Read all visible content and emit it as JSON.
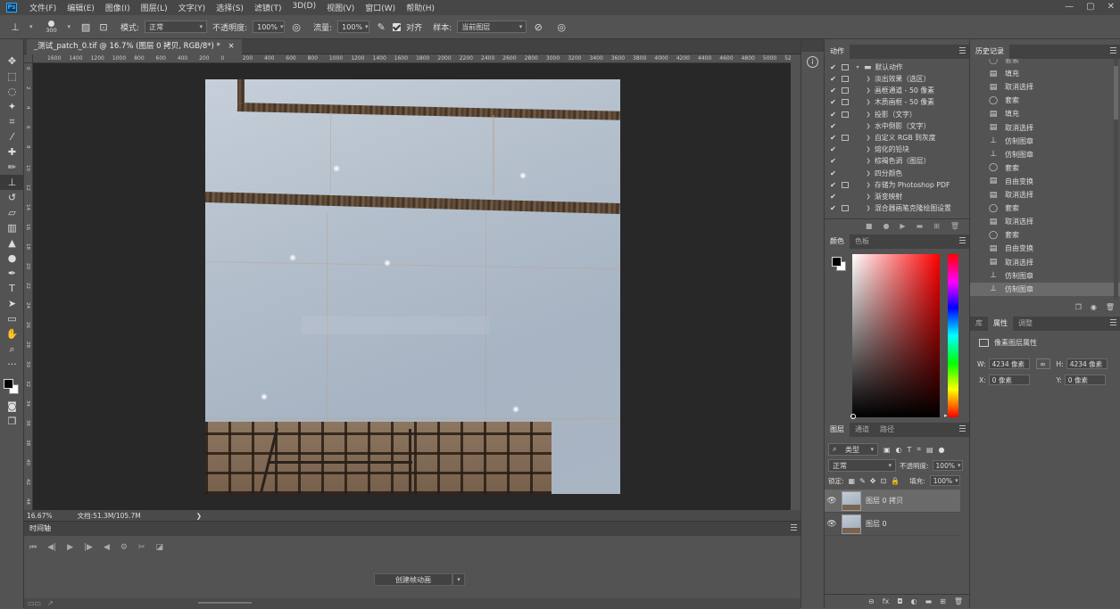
{
  "app": {
    "logo": "Ps"
  },
  "menu": [
    "文件(F)",
    "编辑(E)",
    "图像(I)",
    "图层(L)",
    "文字(Y)",
    "选择(S)",
    "滤镜(T)",
    "3D(D)",
    "视图(V)",
    "窗口(W)",
    "帮助(H)"
  ],
  "window_controls": [
    "—",
    "▢",
    "✕"
  ],
  "options": {
    "brush_size": "300",
    "mode_label": "模式:",
    "mode_value": "正常",
    "opacity_label": "不透明度:",
    "opacity_value": "100%",
    "flow_label": "流量:",
    "flow_value": "100%",
    "align_label": "对齐",
    "sample_label": "样本:",
    "sample_value": "当前图层"
  },
  "document": {
    "tab_title": "_测试_patch_0.tif @ 16.7% (图层 0 拷贝, RGB/8*) *",
    "ruler_h": [
      "1600",
      "1400",
      "1200",
      "1000",
      "800",
      "600",
      "400",
      "200",
      "0",
      "200",
      "400",
      "600",
      "800",
      "1000",
      "1200",
      "1400",
      "1600",
      "1800",
      "2000",
      "2200",
      "2400",
      "2600",
      "2800",
      "3000",
      "3200",
      "3400",
      "3600",
      "3800",
      "4000",
      "4200",
      "4400",
      "4600",
      "4800",
      "5000",
      "5200",
      "5400",
      "5600",
      "5800",
      "6000"
    ],
    "ruler_v": [
      "0",
      "2",
      "4",
      "6",
      "8",
      "10",
      "12",
      "14",
      "16",
      "18",
      "20",
      "22",
      "24",
      "26",
      "28",
      "30",
      "32",
      "34",
      "36",
      "38",
      "40",
      "42",
      "44"
    ]
  },
  "status": {
    "zoom": "16.67%",
    "doc_size": "文档:51.3M/105.7M",
    "arrow": "❯"
  },
  "timeline": {
    "tab": "时间轴",
    "create_button": "创建帧动画"
  },
  "actions_panel": {
    "tab": "动作",
    "set_name": "默认动作",
    "items": [
      "淡出效果（选区）",
      "画框通道 - 50 像素",
      "木质画框 - 50 像素",
      "投影（文字）",
      "水中倒影（文字）",
      "自定义 RGB 到灰度",
      "熔化的铅块",
      "棕褐色调（图层）",
      "四分颜色",
      "存储为 Photoshop PDF",
      "渐变映射",
      "混合器画笔克隆绘图设置"
    ],
    "has_dialog": [
      true,
      true,
      true,
      true,
      false,
      true,
      false,
      false,
      false,
      true,
      false,
      true
    ]
  },
  "color_panel": {
    "tabs": [
      "颜色",
      "色板"
    ],
    "fg": "#000000",
    "bg": "#ffffff"
  },
  "layers_panel": {
    "tabs": [
      "图层",
      "通道",
      "路径"
    ],
    "kind_filter": "类型",
    "blend_mode": "正常",
    "opacity_label": "不透明度:",
    "opacity_value": "100%",
    "lock_label": "锁定:",
    "fill_label": "填充:",
    "fill_value": "100%",
    "layers": [
      {
        "name": "图层 0 拷贝",
        "selected": true
      },
      {
        "name": "图层 0",
        "selected": false
      }
    ],
    "footer_icons": [
      "link-icon",
      "fx-icon",
      "mask-icon",
      "adjustment-icon",
      "folder-icon",
      "new-layer-icon",
      "trash-icon"
    ]
  },
  "history_panel": {
    "tab": "历史记录",
    "items": [
      {
        "label": "套索",
        "icon": "lasso"
      },
      {
        "label": "填充",
        "icon": "doc"
      },
      {
        "label": "取消选择",
        "icon": "doc"
      },
      {
        "label": "套索",
        "icon": "lasso"
      },
      {
        "label": "填充",
        "icon": "doc"
      },
      {
        "label": "取消选择",
        "icon": "doc"
      },
      {
        "label": "仿制图章",
        "icon": "stamp"
      },
      {
        "label": "仿制图章",
        "icon": "stamp"
      },
      {
        "label": "套索",
        "icon": "lasso"
      },
      {
        "label": "自由变换",
        "icon": "doc"
      },
      {
        "label": "取消选择",
        "icon": "doc"
      },
      {
        "label": "套索",
        "icon": "lasso"
      },
      {
        "label": "取消选择",
        "icon": "doc"
      },
      {
        "label": "套索",
        "icon": "lasso"
      },
      {
        "label": "自由变换",
        "icon": "doc"
      },
      {
        "label": "取消选择",
        "icon": "doc"
      },
      {
        "label": "仿制图章",
        "icon": "stamp"
      },
      {
        "label": "仿制图章",
        "icon": "stamp"
      }
    ]
  },
  "properties_panel": {
    "tabs": [
      "库",
      "属性",
      "调整"
    ],
    "title": "像素图层属性",
    "w_label": "W:",
    "w_value": "4234 像素",
    "h_label": "H:",
    "h_value": "4234 像素",
    "x_label": "X:",
    "x_value": "0 像素",
    "y_label": "Y:",
    "y_value": "0 像素"
  }
}
